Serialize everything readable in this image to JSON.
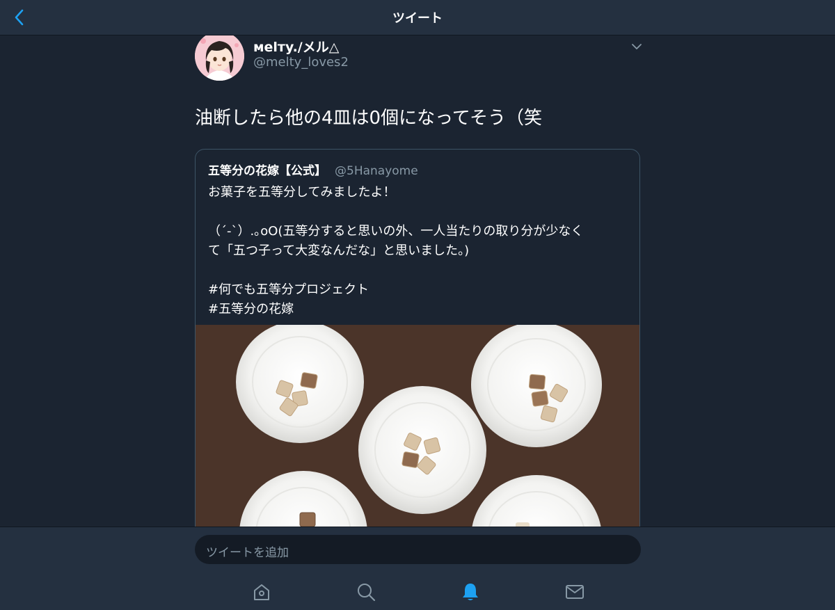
{
  "header": {
    "title": "ツイート",
    "back_icon": "chevron-left-icon",
    "accent_color": "#1da1f2"
  },
  "tweet": {
    "display_name": "мelтy./メル△",
    "handle": "@melty_loves2",
    "text": "油断したら他の4皿は0個になってそう（笑"
  },
  "quoted_tweet": {
    "name": "五等分の花嫁【公式】",
    "handle": "@5Hanayome",
    "lines": [
      "お菓子を五等分してみましたよ！",
      "",
      "（´-`）.｡oO(五等分すると思いの外、一人当たりの取り分が少なく",
      "て「五つ子って大変なんだな」と思いました。)",
      "",
      "#何でも五等分プロジェクト",
      "#五等分の花嫁"
    ]
  },
  "reply": {
    "placeholder": "ツイートを追加"
  },
  "bottom_nav": [
    {
      "icon": "home-icon",
      "active": false
    },
    {
      "icon": "search-icon",
      "active": false
    },
    {
      "icon": "bell-icon",
      "active": true
    },
    {
      "icon": "mail-icon",
      "active": false
    }
  ]
}
